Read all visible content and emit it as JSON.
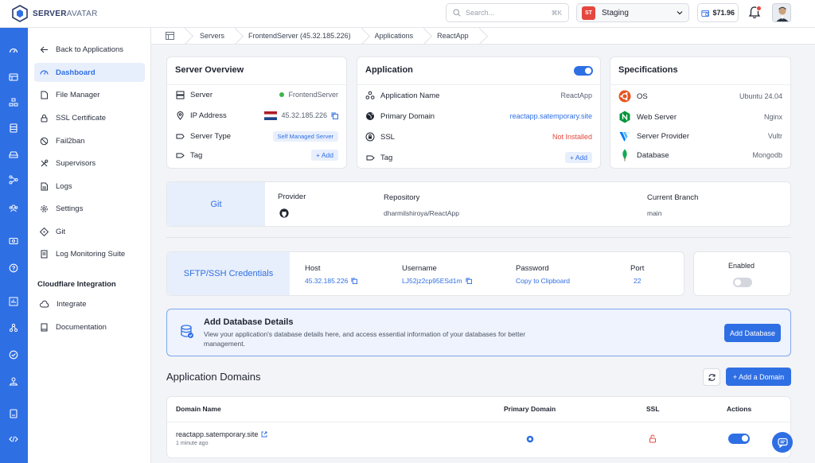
{
  "brand": {
    "name_bold": "SERVER",
    "name_light": "AVATAR"
  },
  "search": {
    "placeholder": "Search...",
    "shortcut": "⌘K"
  },
  "env": {
    "badge": "ST",
    "name": "Staging"
  },
  "balance": "$71.96",
  "breadcrumb": [
    "Servers",
    "FrontendServer (45.32.185.226)",
    "Applications",
    "ReactApp"
  ],
  "sidebar": {
    "back": "Back to Applications",
    "items": [
      {
        "label": "Dashboard",
        "icon": "dashboard-icon",
        "active": true
      },
      {
        "label": "File Manager",
        "icon": "file-icon"
      },
      {
        "label": "SSL Certificate",
        "icon": "lock-icon"
      },
      {
        "label": "Fail2ban",
        "icon": "ban-icon"
      },
      {
        "label": "Supervisors",
        "icon": "tools-icon"
      },
      {
        "label": "Logs",
        "icon": "log-icon"
      },
      {
        "label": "Settings",
        "icon": "gear-icon"
      },
      {
        "label": "Git",
        "icon": "git-icon"
      },
      {
        "label": "Log Monitoring Suite",
        "icon": "document-icon"
      }
    ],
    "cloudflare_heading": "Cloudflare Integration",
    "cloudflare_items": [
      {
        "label": "Integrate",
        "icon": "cloud-icon"
      },
      {
        "label": "Documentation",
        "icon": "book-icon"
      }
    ]
  },
  "server_overview": {
    "title": "Server Overview",
    "rows": [
      {
        "label": "Server",
        "value": "FrontendServer",
        "icon": "server-icon"
      },
      {
        "label": "IP Address",
        "value": "45.32.185.226",
        "icon": "pin-icon"
      },
      {
        "label": "Server Type",
        "value": "Self Managed Server",
        "icon": "type-icon"
      },
      {
        "label": "Tag",
        "value": "+ Add",
        "icon": "tag-icon"
      }
    ]
  },
  "application": {
    "title": "Application",
    "enabled": true,
    "rows": [
      {
        "label": "Application Name",
        "value": "ReactApp",
        "icon": "app-icon"
      },
      {
        "label": "Primary Domain",
        "value": "reactapp.satemporary.site",
        "icon": "globe-icon"
      },
      {
        "label": "SSL",
        "value": "Not Installed",
        "icon": "ssl-icon"
      },
      {
        "label": "Tag",
        "value": "+ Add",
        "icon": "tag-icon"
      }
    ]
  },
  "specifications": {
    "title": "Specifications",
    "rows": [
      {
        "label": "OS",
        "value": "Ubuntu 24.04",
        "icon": "ubuntu-icon"
      },
      {
        "label": "Web Server",
        "value": "Nginx",
        "icon": "nginx-icon"
      },
      {
        "label": "Server Provider",
        "value": "Vultr",
        "icon": "vultr-icon"
      },
      {
        "label": "Database",
        "value": "Mongodb",
        "icon": "mongodb-icon"
      }
    ]
  },
  "git": {
    "title": "Git",
    "provider_label": "Provider",
    "repository_label": "Repository",
    "repository": "dharmilshiroya/ReactApp",
    "branch_label": "Current Branch",
    "branch": "main"
  },
  "sftp": {
    "title": "SFTP/SSH Credentials",
    "host_label": "Host",
    "host": "45.32.185.226",
    "username_label": "Username",
    "username": "LJ52jz2cp95ESd1m",
    "password_label": "Password",
    "password": "Copy to Clipboard",
    "port_label": "Port",
    "port": "22",
    "enabled_label": "Enabled",
    "enabled": false
  },
  "db_banner": {
    "title": "Add Database Details",
    "text1": "View your application's database details here, and access essential information of your databases for better",
    "text2": "management.",
    "button": "Add Database"
  },
  "domains": {
    "title": "Application Domains",
    "add_button": "+ Add a Domain",
    "columns": [
      "Domain Name",
      "Primary Domain",
      "SSL",
      "Actions"
    ],
    "rows": [
      {
        "domain": "reactapp.satemporary.site",
        "time": "1 minute ago",
        "primary": true,
        "ssl": false,
        "active": true
      }
    ]
  },
  "colors": {
    "accent": "#2f6fe4",
    "danger": "#e4473f",
    "success": "#3bb54a"
  }
}
